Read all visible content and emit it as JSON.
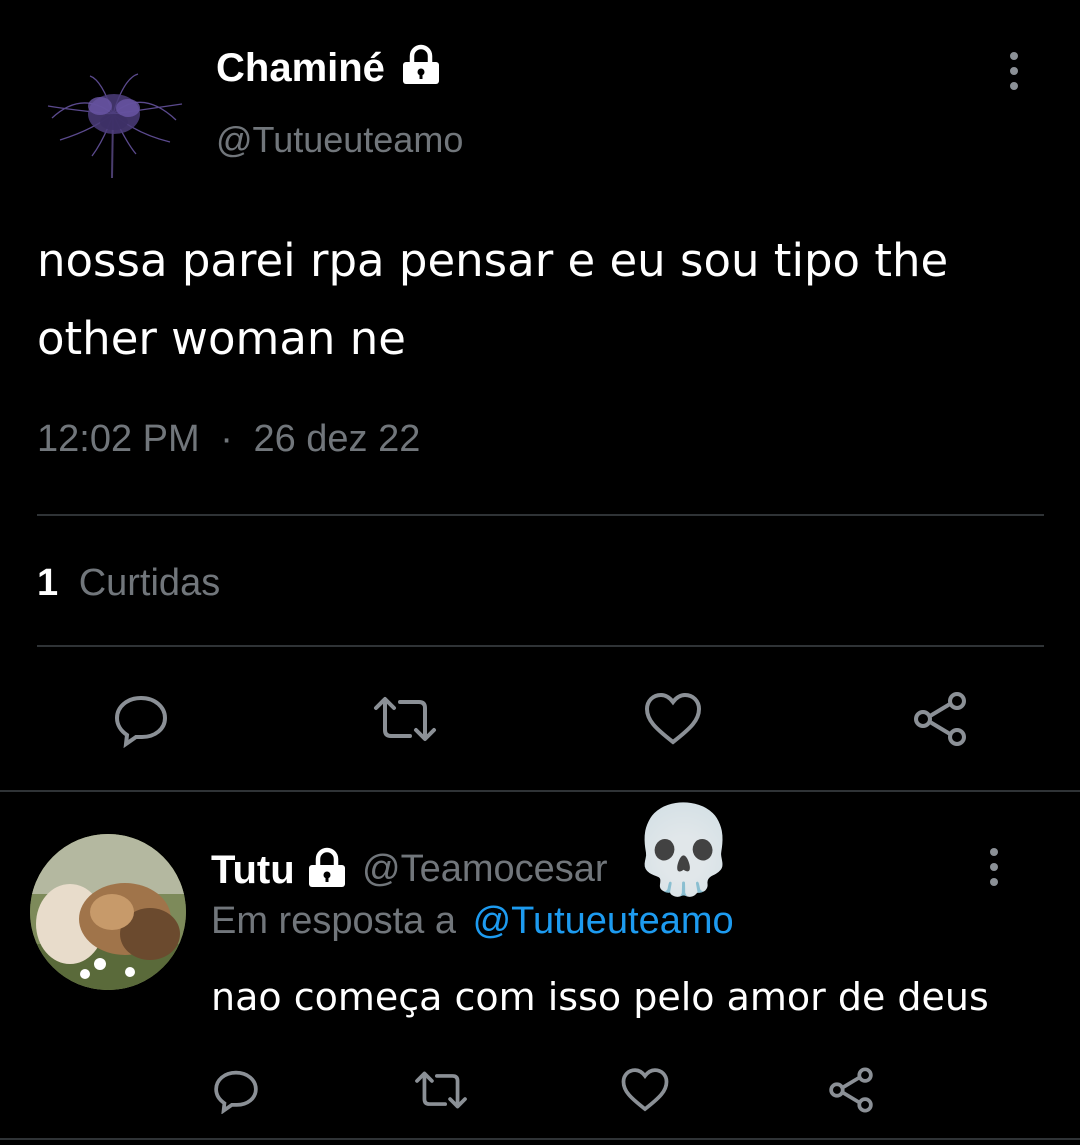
{
  "tweet": {
    "author_name": "Chaminé",
    "author_handle": "@Tutueuteamo",
    "author_icons": [
      "lock-icon"
    ],
    "avatar": "purple-spider-lily-avatar",
    "text": "nossa parei rpa pensar e eu sou tipo the other woman ne",
    "time": "12:02 PM",
    "separator": "·",
    "date": "26 dez 22",
    "likes_count": "1",
    "likes_label": "Curtidas"
  },
  "reply": {
    "author_name": "Tutu",
    "author_handle": "@Teamocesar",
    "author_icons": [
      "lock-icon"
    ],
    "avatar": "cat-photo-avatar",
    "reply_prefix": "Em resposta a",
    "reply_to": "@Tutueuteamo",
    "text": "nao começa com isso pelo amor de deus",
    "overlay_emoji": "💀"
  },
  "actions": [
    "reply-icon",
    "retweet-icon",
    "like-icon",
    "share-icon"
  ],
  "colors": {
    "background": "#000000",
    "text": "#e7e9ea",
    "muted": "#71767b",
    "link": "#1d9bf0",
    "divider": "#2f3336",
    "avatar_flower": "#5b4a8e"
  }
}
